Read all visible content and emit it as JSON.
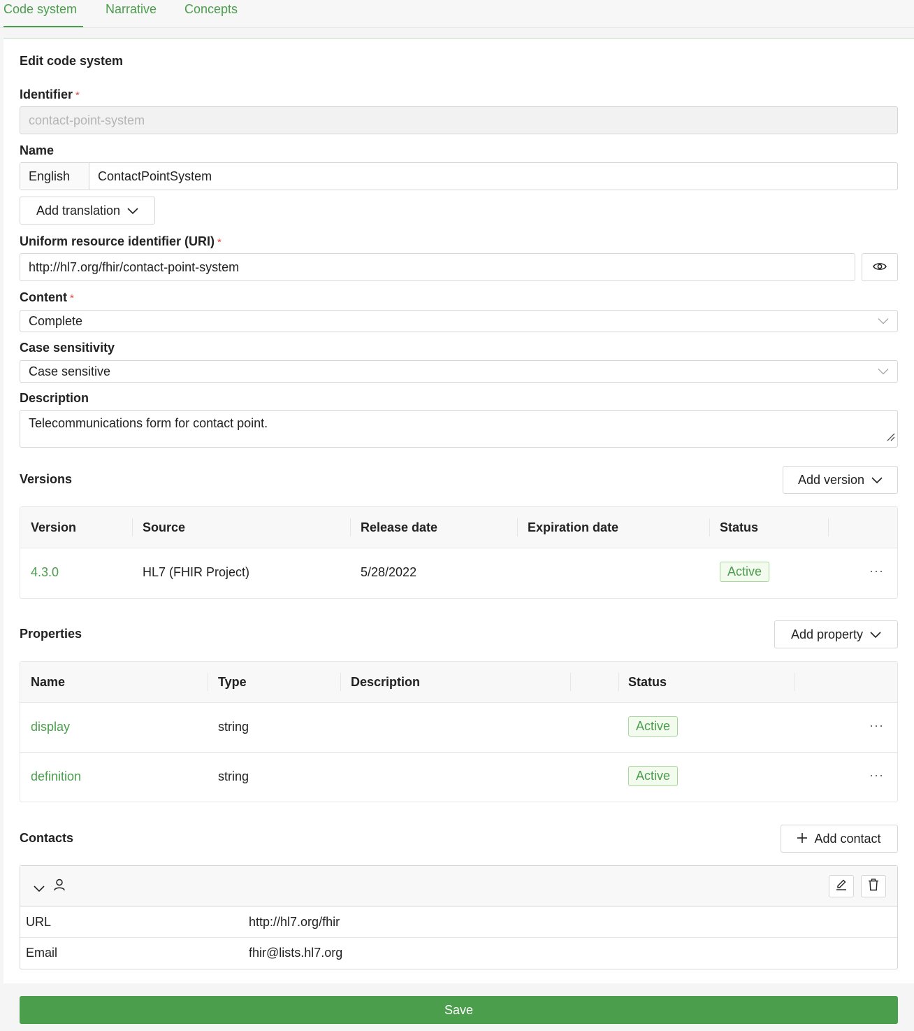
{
  "tabs": [
    {
      "label": "Code system",
      "active": true
    },
    {
      "label": "Narrative",
      "active": false
    },
    {
      "label": "Concepts",
      "active": false
    }
  ],
  "form": {
    "title": "Edit code system",
    "identifier": {
      "label": "Identifier",
      "required_mark": "*",
      "value": "contact-point-system"
    },
    "name": {
      "label": "Name",
      "language": "English",
      "value": "ContactPointSystem",
      "add_translation_label": "Add translation"
    },
    "uri": {
      "label": "Uniform resource identifier (URI)",
      "required_mark": "*",
      "value": "http://hl7.org/fhir/contact-point-system"
    },
    "content": {
      "label": "Content",
      "required_mark": "*",
      "value": "Complete"
    },
    "case_sensitivity": {
      "label": "Case sensitivity",
      "value": "Case sensitive"
    },
    "description": {
      "label": "Description",
      "value": "Telecommunications form for contact point."
    }
  },
  "versions": {
    "title": "Versions",
    "add_label": "Add version",
    "columns": [
      "Version",
      "Source",
      "Release date",
      "Expiration date",
      "Status"
    ],
    "rows": [
      {
        "version": "4.3.0",
        "source": "HL7 (FHIR Project)",
        "release_date": "5/28/2022",
        "expiration_date": "",
        "status": "Active"
      }
    ]
  },
  "properties": {
    "title": "Properties",
    "add_label": "Add property",
    "columns": [
      "Name",
      "Type",
      "Description",
      "Status"
    ],
    "rows": [
      {
        "name": "display",
        "type": "string",
        "description": "",
        "status": "Active"
      },
      {
        "name": "definition",
        "type": "string",
        "description": "",
        "status": "Active"
      }
    ]
  },
  "contacts": {
    "title": "Contacts",
    "add_label": "Add contact",
    "items": [
      {
        "rows": [
          {
            "key": "URL",
            "value": "http://hl7.org/fhir"
          },
          {
            "key": "Email",
            "value": "fhir@lists.hl7.org"
          }
        ]
      }
    ]
  },
  "save_label": "Save",
  "more_glyph": "···",
  "colors": {
    "accent": "#4a9e4c",
    "required": "#e04b4b",
    "badge_border": "#a6d89a"
  }
}
